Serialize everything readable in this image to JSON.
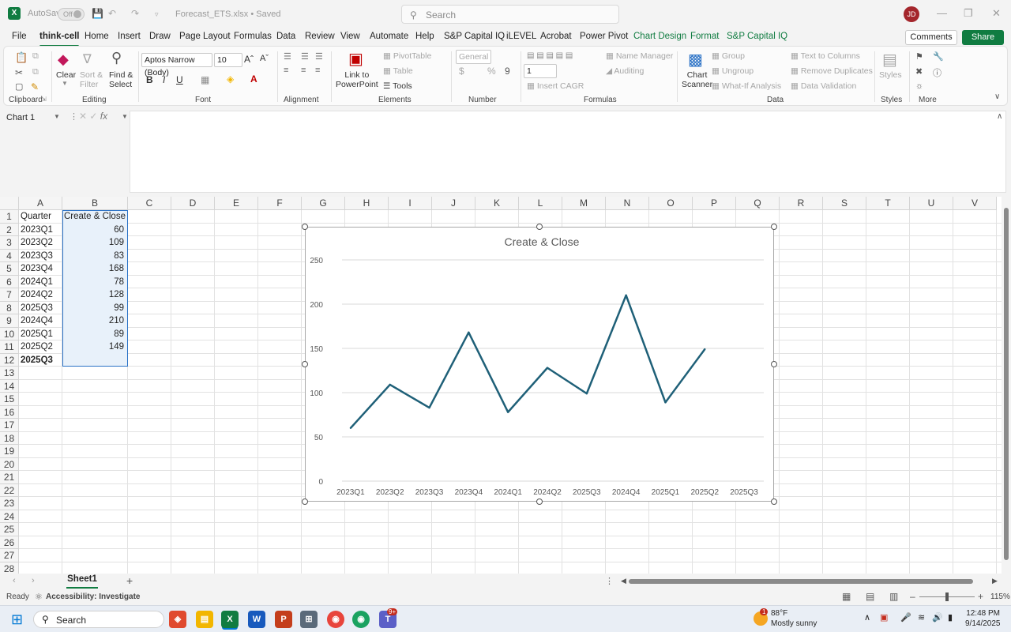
{
  "titlebar": {
    "autosave_label": "AutoSave",
    "autosave_state": "Off",
    "document_name": "Forecast_ETS.xlsx • Saved",
    "search_placeholder": "Search",
    "avatar_initials": "JD"
  },
  "tabs": [
    "File",
    "think-cell",
    "Home",
    "Insert",
    "Draw",
    "Page Layout",
    "Formulas",
    "Data",
    "Review",
    "View",
    "Automate",
    "Help",
    "S&P Capital IQ",
    "iLEVEL",
    "Acrobat",
    "Power Pivot",
    "Chart Design",
    "Format",
    "S&P Capital IQ"
  ],
  "active_tab": "think-cell",
  "header_buttons": {
    "comments": "Comments",
    "share": "Share"
  },
  "ribbon": {
    "groups": {
      "clipboard": "Clipboard",
      "editing": "Editing",
      "font": "Font",
      "alignment": "Alignment",
      "elements": "Elements",
      "number": "Number",
      "formulas": "Formulas",
      "data": "Data",
      "styles": "Styles",
      "more": "More"
    },
    "clear": "Clear",
    "sort_filter": "Sort &\nFilter",
    "find_select": "Find &\nSelect",
    "font_name": "Aptos Narrow (Body)",
    "font_size": "10",
    "link_to_ppt": "Link to\nPowerPoint",
    "pivot_table": "PivotTable",
    "table": "Table",
    "tools": "Tools",
    "number_format": "General",
    "decimals": "1",
    "insert_cagr": "Insert CAGR",
    "name_manager": "Name Manager",
    "auditing": "Auditing",
    "chart_scanner": "Chart\nScanner",
    "group": "Group",
    "ungroup": "Ungroup",
    "what_if": "What-If Analysis",
    "text_to_columns": "Text to Columns",
    "remove_duplicates": "Remove Duplicates",
    "data_validation": "Data Validation",
    "styles_btn": "Styles"
  },
  "formula_bar": {
    "name_box": "Chart 1",
    "fx": "fx"
  },
  "columns": [
    "A",
    "B",
    "C",
    "D",
    "E",
    "F",
    "G",
    "H",
    "I",
    "J",
    "K",
    "L",
    "M",
    "N",
    "O",
    "P",
    "Q",
    "R",
    "S",
    "T",
    "U",
    "V"
  ],
  "rows": [
    "1",
    "2",
    "3",
    "4",
    "5",
    "6",
    "7",
    "8",
    "9",
    "10",
    "11",
    "12",
    "13",
    "14",
    "15",
    "16",
    "17",
    "18",
    "19",
    "20",
    "21",
    "22",
    "23",
    "24",
    "25",
    "26",
    "27",
    "28"
  ],
  "table": {
    "header_a": "Quarter",
    "header_b": "Create & Close",
    "quarters": [
      "2023Q1",
      "2023Q2",
      "2023Q3",
      "2023Q4",
      "2024Q1",
      "2024Q2",
      "2025Q3",
      "2024Q4",
      "2025Q1",
      "2025Q2",
      "2025Q3"
    ],
    "values": [
      "60",
      "109",
      "83",
      "168",
      "78",
      "128",
      "99",
      "210",
      "89",
      "149",
      ""
    ]
  },
  "chart_data": {
    "type": "line",
    "title": "Create & Close",
    "categories": [
      "2023Q1",
      "2023Q2",
      "2023Q3",
      "2023Q4",
      "2024Q1",
      "2024Q2",
      "2025Q3",
      "2024Q4",
      "2025Q1",
      "2025Q2",
      "2025Q3"
    ],
    "series": [
      {
        "values": [
          60,
          109,
          83,
          168,
          78,
          128,
          99,
          210,
          89,
          149,
          null
        ],
        "color": "#1f6078"
      }
    ],
    "ylim": [
      0,
      250
    ],
    "yticks": [
      "0",
      "50",
      "100",
      "150",
      "200",
      "250"
    ],
    "grid": true,
    "legend": "none"
  },
  "sheet_tab": "Sheet1",
  "status": {
    "ready": "Ready",
    "accessibility": "Accessibility: Investigate",
    "zoom": "115%"
  },
  "taskbar": {
    "search": "Search",
    "weather_temp": "88°F",
    "weather_desc": "Mostly sunny",
    "time": "12:48 PM",
    "date": "9/14/2025",
    "teams_badge": "9+",
    "weather_badge": "1"
  }
}
